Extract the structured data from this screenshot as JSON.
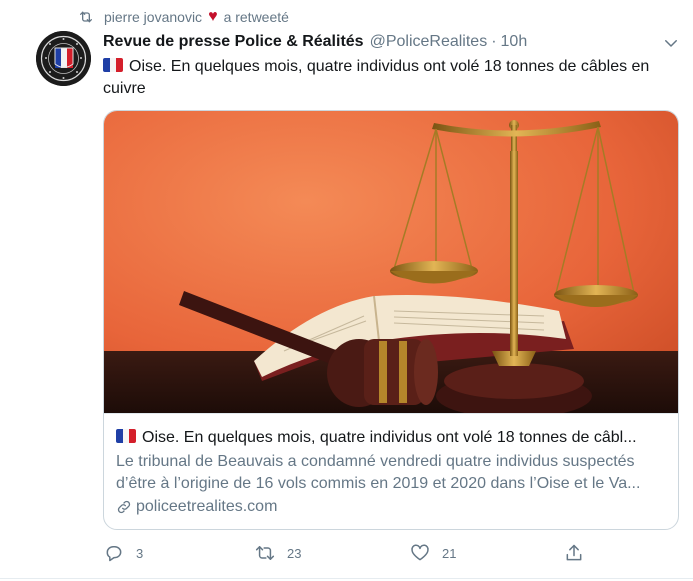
{
  "retweet": {
    "user": "pierre jovanovic",
    "label": "a retweeté"
  },
  "tweet": {
    "author_name": "Revue de presse Police & Réalités",
    "handle": "@PoliceRealites",
    "separator": "·",
    "time": "10h",
    "text": "Oise. En quelques mois, quatre individus ont volé 18 tonnes de câbles en cuivre"
  },
  "card": {
    "title": "Oise. En quelques mois, quatre individus ont volé 18 tonnes de câbl...",
    "description_line1": "Le tribunal de Beauvais a condamné vendredi quatre individus suspectés",
    "description_line2": "d’être à l’origine de 16 vols commis en 2019 et 2020 dans l’Oise et le Va...",
    "domain": "policeetrealites.com"
  },
  "actions": {
    "replies": "3",
    "retweets": "23",
    "likes": "21"
  },
  "colors": {
    "text_primary": "#14171a",
    "text_secondary": "#657786",
    "heart": "#c4102b",
    "border": "#ccd6dd"
  }
}
